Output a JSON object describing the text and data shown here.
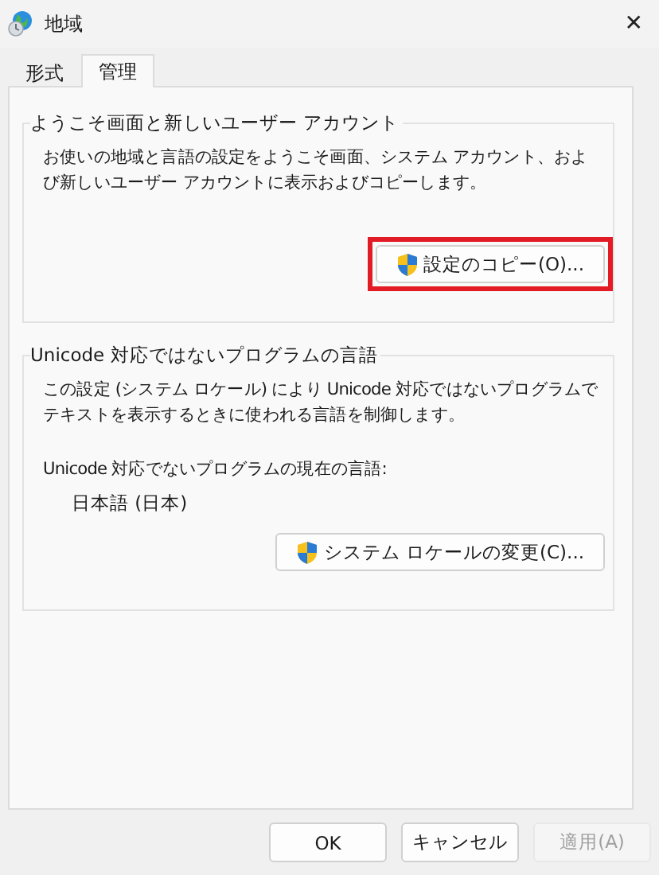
{
  "window": {
    "title": "地域",
    "close": "✕"
  },
  "tabs": [
    {
      "label": "形式",
      "selected": false
    },
    {
      "label": "管理",
      "selected": true
    }
  ],
  "groups": [
    {
      "title": "ようこそ画面と新しいユーザー アカウント",
      "description": "お使いの地域と言語の設定をようこそ画面、システム アカウント、および新しいユーザー アカウントに表示およびコピーします。",
      "button": {
        "label": "設定のコピー(O)...",
        "highlighted": true
      }
    },
    {
      "title": "Unicode 対応ではないプログラムの言語",
      "description": "この設定 (システム ロケール) により Unicode 対応ではないプログラムでテキストを表示するときに使われる言語を制御します。",
      "current_label": "Unicode 対応でないプログラムの現在の言語:",
      "current_value": "日本語 (日本)",
      "button": {
        "label": "システム ロケールの変更(C)...",
        "highlighted": false
      }
    }
  ],
  "buttons": [
    {
      "label": "OK",
      "disabled": false
    },
    {
      "label": "キャンセル",
      "disabled": false
    },
    {
      "label": "適用(A)",
      "disabled": true
    }
  ]
}
